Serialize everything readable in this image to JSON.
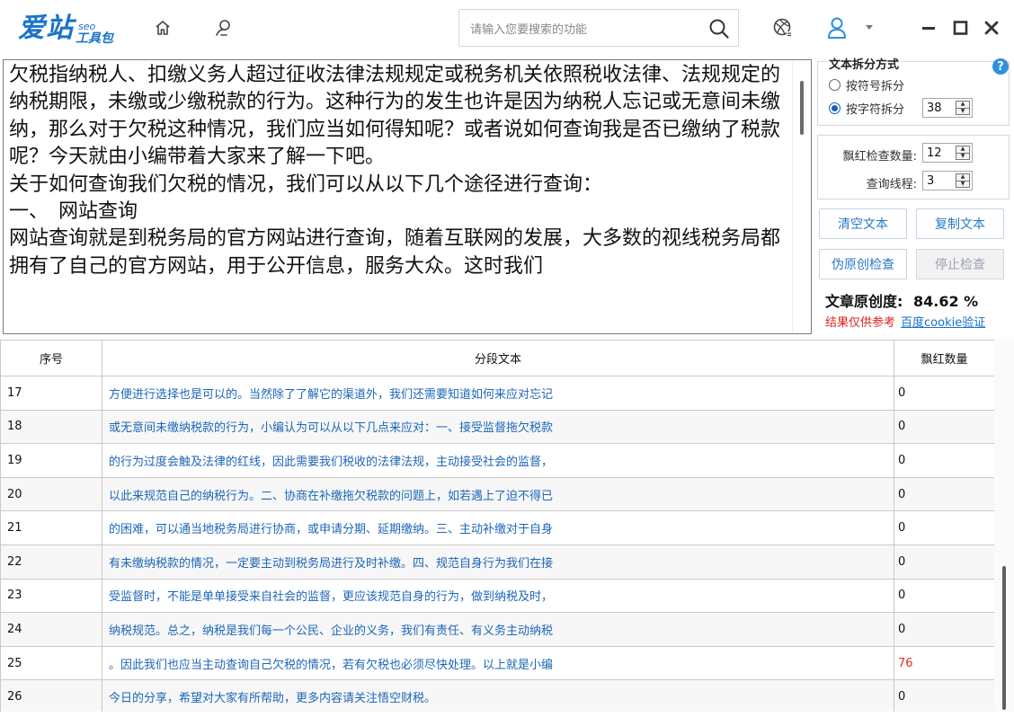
{
  "app": {
    "logo_main": "爱站",
    "logo_seo": "seo",
    "logo_sub": "工具包"
  },
  "icons": {
    "home": "home-icon",
    "skin": "skin-icon",
    "search": "search-icon",
    "basketball": "basketball-icon",
    "user": "user-icon",
    "dropdown": "caret-down-icon",
    "minimize": "minimize-icon",
    "maximize": "maximize-icon",
    "close": "close-icon",
    "help": "help-icon"
  },
  "search": {
    "placeholder": "请输入您要搜索的功能",
    "value": ""
  },
  "editor": {
    "text": "欠税指纳税人、扣缴义务人超过征收法律法规规定或税务机关依照税收法律、法规规定的纳税期限，未缴或少缴税款的行为。这种行为的发生也许是因为纳税人忘记或无意间未缴纳，那么对于欠税这种情况，我们应当如何得知呢？或者说如何查询我是否已缴纳了税款呢？今天就由小编带着大家来了解一下吧。\n关于如何查询我们欠税的情况，我们可以从以下几个途径进行查询：\n一、　网站查询\n网站查询就是到税务局的官方网站进行查询，随着互联网的发展，大多数的视线税务局都拥有了自己的官方网站，用于公开信息，服务大众。这时我们"
  },
  "panel": {
    "split_title": "文本拆分方式",
    "help_glyph": "?",
    "radio_symbol": "按符号拆分",
    "radio_char": "按字符拆分",
    "radio_selected": "按字符拆分",
    "char_count": "38",
    "check_count_label": "飘红检查数量:",
    "check_count": "12",
    "threads_label": "查询线程:",
    "threads": "3",
    "btn_clear": "清空文本",
    "btn_copy": "复制文本",
    "btn_check": "伪原创检查",
    "btn_stop": "停止检查",
    "originality_label": "文章原创度:",
    "originality_value": "84.62 %",
    "warning": "结果仅供参考",
    "cookie_link": "百度cookie验证"
  },
  "table": {
    "headers": [
      "序号",
      "分段文本",
      "飘红数量"
    ],
    "rows": [
      {
        "no": "17",
        "text": "方便进行选择也是可以的。当然除了了解它的渠道外，我们还需要知道如何来应对忘记",
        "count": "0"
      },
      {
        "no": "18",
        "text": "或无意间未缴纳税款的行为，小编认为可以从以下几点来应对：一、接受监督拖欠税款",
        "count": "0"
      },
      {
        "no": "19",
        "text": "的行为过度会触及法律的红线，因此需要我们税收的法律法规，主动接受社会的监督，",
        "count": "0"
      },
      {
        "no": "20",
        "text": "以此来规范自己的纳税行为。二、协商在补缴拖欠税款的问题上，如若遇上了迫不得已",
        "count": "0"
      },
      {
        "no": "21",
        "text": "的困难，可以通当地税务局进行协商，或申请分期、延期缴纳。三、主动补缴对于自身",
        "count": "0"
      },
      {
        "no": "22",
        "text": "有未缴纳税款的情况，一定要主动到税务局进行及时补缴。四、规范自身行为我们在接",
        "count": "0"
      },
      {
        "no": "23",
        "text": "受监督时，不能是单单接受来自社会的监督，更应该规范自身的行为，做到纳税及时，",
        "count": "0"
      },
      {
        "no": "24",
        "text": "纳税规范。总之，纳税是我们每一个公民、企业的义务，我们有责任、有义务主动纳税",
        "count": "0"
      },
      {
        "no": "25",
        "text": "。因此我们也应当主动查询自己欠税的情况，若有欠税也必须尽快处理。以上就是小编",
        "count": "76"
      },
      {
        "no": "26",
        "text": "今日的分享，希望对大家有所帮助，更多内容请关注悟空财税。",
        "count": "0"
      }
    ],
    "highlight_color": "#e62c1f"
  },
  "colors": {
    "brand": "#1a73c9",
    "segment_text": "#1d66b7",
    "warning": "#e02020",
    "link": "#1a6fd0"
  }
}
